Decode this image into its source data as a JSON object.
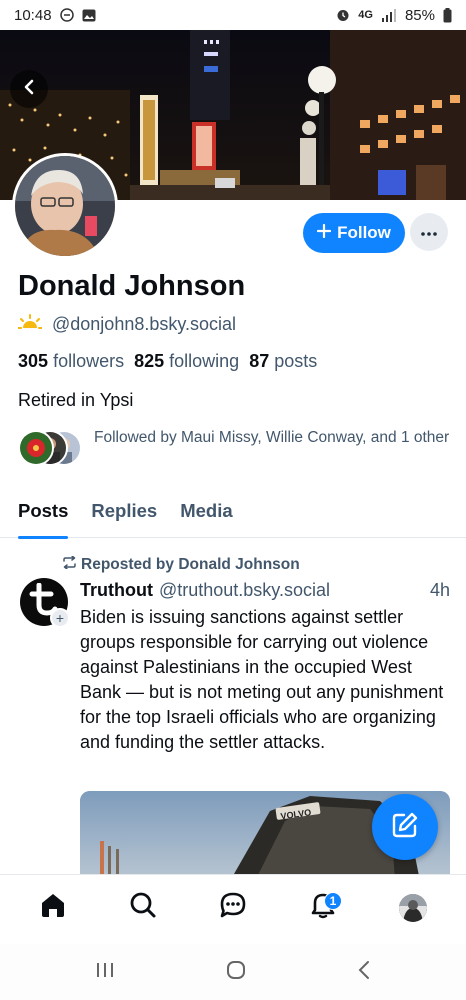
{
  "status_bar": {
    "time": "10:48",
    "network": "4G",
    "battery": "85%"
  },
  "profile": {
    "display_name": "Donald Johnson",
    "handle": "@donjohn8.bsky.social",
    "followers_count": "305",
    "followers_label": "followers",
    "following_count": "825",
    "following_label": "following",
    "posts_count": "87",
    "posts_label": "posts",
    "bio": "Retired in Ypsi",
    "followed_by": "Followed by Maui Missy, Willie Conway, and 1 other"
  },
  "actions": {
    "follow_label": "Follow",
    "follow_icon": "plus-icon",
    "more_icon": "ellipsis-icon"
  },
  "tabs": [
    {
      "label": "Posts",
      "active": true
    },
    {
      "label": "Replies",
      "active": false
    },
    {
      "label": "Media",
      "active": false
    }
  ],
  "post": {
    "repost_label": "Reposted by Donald Johnson",
    "author": "Truthout",
    "handle": "@truthout.bsky.social",
    "time": "4h",
    "text": "Biden is issuing sanctions against settler groups responsible for carrying out violence against Palestinians in the occupied West Bank — but is not meting out any punishment for the top Israeli officials who are organizing and funding the settler attacks.",
    "image_caption_text": "VOLVO"
  },
  "bottom_nav": {
    "items": [
      "home-icon",
      "search-icon",
      "chat-icon",
      "bell-icon",
      "profile-avatar"
    ],
    "notification_count": "1"
  },
  "colors": {
    "accent": "#1083fe",
    "muted_text": "#42576c",
    "primary_text": "#0b0f14"
  }
}
